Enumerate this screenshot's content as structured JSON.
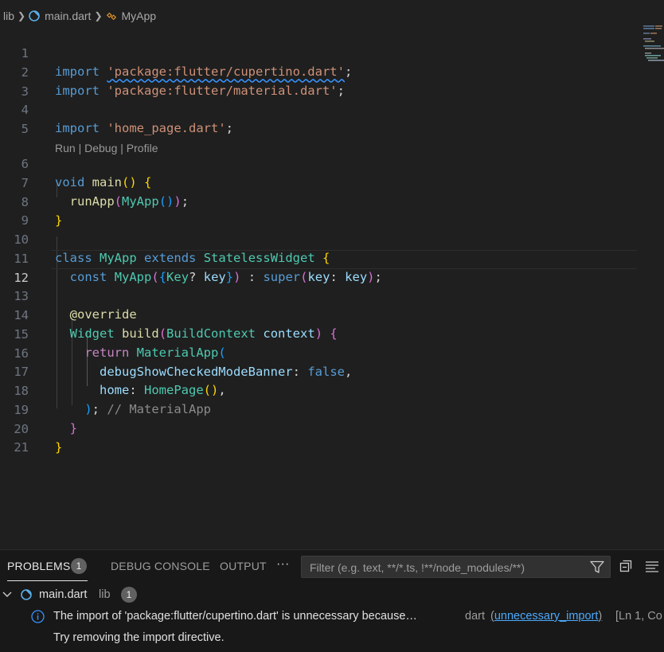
{
  "breadcrumb": {
    "folder": "lib",
    "file": "main.dart",
    "symbol": "MyApp",
    "file_icon": "dart-file-icon",
    "symbol_icon": "class-symbol-icon"
  },
  "codelens": {
    "run": "Run",
    "debug": "Debug",
    "profile": "Profile",
    "sep": " | "
  },
  "lines": [
    {
      "n": "1"
    },
    {
      "n": "2"
    },
    {
      "n": "3"
    },
    {
      "n": "4"
    },
    {
      "n": "5"
    },
    {
      "n": "6"
    },
    {
      "n": "7"
    },
    {
      "n": "8"
    },
    {
      "n": "9"
    },
    {
      "n": "10"
    },
    {
      "n": "11"
    },
    {
      "n": "12"
    },
    {
      "n": "13"
    },
    {
      "n": "14"
    },
    {
      "n": "15"
    },
    {
      "n": "16"
    },
    {
      "n": "17"
    },
    {
      "n": "18"
    },
    {
      "n": "19"
    },
    {
      "n": "20"
    },
    {
      "n": "21"
    }
  ],
  "code": {
    "import": "import",
    "s_cupertino": "'package:flutter/cupertino.dart'",
    "s_material": "'package:flutter/material.dart'",
    "s_home": "'home_page.dart'",
    "semi": ";",
    "void": "void",
    "main": "main",
    "runApp": "runApp",
    "MyApp": "MyApp",
    "class": "class",
    "extends": "extends",
    "StatelessWidget": "StatelessWidget",
    "const": "const",
    "Key": "Key",
    "key": "key",
    "super": "super",
    "override": "@override",
    "Widget": "Widget",
    "build": "build",
    "BuildContext": "BuildContext",
    "context": "context",
    "return": "return",
    "MaterialApp": "MaterialApp",
    "debugShowCheckedModeBanner": "debugShowCheckedModeBanner",
    "false": "false",
    "home": "home",
    "HomePage": "HomePage",
    "comment_materialapp": "// MaterialApp"
  },
  "panel": {
    "tabs": [
      "PROBLEMS",
      "DEBUG CONSOLE",
      "OUTPUT"
    ],
    "problems_count": "1",
    "more": "···",
    "filter_placeholder": "Filter (e.g. text, **/*.ts, !**/node_modules/**)",
    "group": {
      "file": "main.dart",
      "folder": "lib",
      "count": "1"
    },
    "problem": {
      "message": "The import of 'package:flutter/cupertino.dart' is unnecessary because…",
      "source": "dart",
      "code": "unnecessary_import",
      "position": "[Ln 1, Co",
      "hint": "Try removing the import directive."
    }
  }
}
